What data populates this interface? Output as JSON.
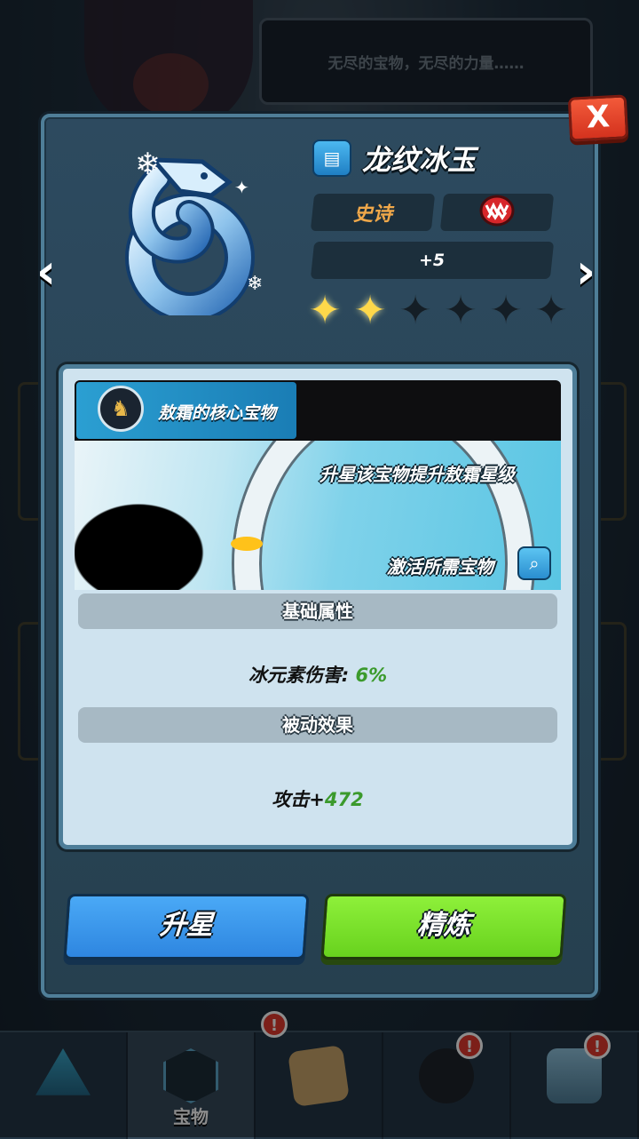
{
  "background": {
    "dialog_text": "无尽的宝物，无尽的力量……"
  },
  "tabbar": {
    "tabs": [
      {
        "icon": "dungeon-crystal-icon",
        "label": ""
      },
      {
        "icon": "treasure-rune-icon",
        "label": "宝物",
        "badge": "!"
      },
      {
        "icon": "treasure-map-icon",
        "label": ""
      },
      {
        "icon": "heroes-icon",
        "label": "",
        "badge": "!"
      },
      {
        "icon": "shop-icon",
        "label": "",
        "badge": "!"
      }
    ]
  },
  "modal": {
    "close_label": "X",
    "prev_label": "‹",
    "next_label": "›",
    "item": {
      "name": "龙纹冰玉",
      "icon": "ice-dragon-jade-icon",
      "rarity": "史诗",
      "rarity_color": "#f0a84a",
      "class_icon": "fanged-monster-icon",
      "level": "+5",
      "stars_filled": 2,
      "stars_total": 6
    },
    "core": {
      "title": "敖霜的核心宝物",
      "banner_line1": "升星该宝物提升敖霜星级",
      "banner_line2": "激活所需宝物"
    },
    "base_attributes": {
      "header": "基础属性",
      "label": "冰元素伤害:",
      "value": "6%"
    },
    "passive": {
      "header": "被动效果",
      "label": "攻击+",
      "value": "472"
    },
    "buttons": {
      "upgrade_star": "升星",
      "refine": "精炼"
    }
  }
}
